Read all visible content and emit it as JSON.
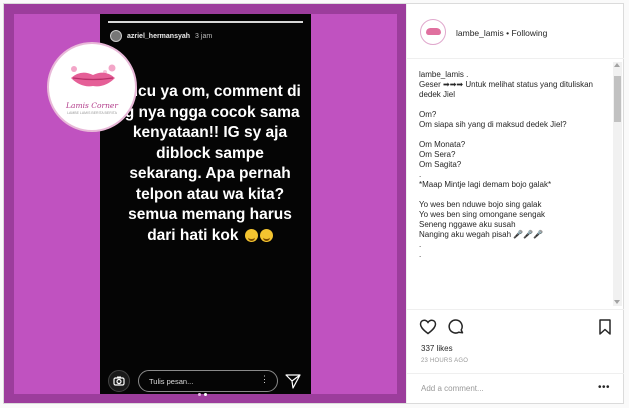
{
  "story": {
    "username": "azriel_hermansyah",
    "time": "3 jam",
    "text": "Lucu ya om, comment di ig nya ngga cocok sama kenyataan!! IG sy aja diblock sampe sekarang. Apa pernah telpon atau wa kita? semua memang harus dari hati kok",
    "reply_placeholder": "Tulis pesan...",
    "reply_more": "⋮"
  },
  "logo": {
    "name": "Lamis Corner",
    "tagline": "LAMBE LAMIS BERITA BERITA"
  },
  "post": {
    "username": "lambe_lamis",
    "separator": "•",
    "follow_status": "Following",
    "caption_user": "lambe_lamis",
    "caption_lines": [
      "lambe_lamis .",
      "Geser ➡➡➡ Untuk melihat status yang dituliskan dedek Jiel",
      "",
      "Om?",
      "Om siapa sih yang di maksud dedek Jiel?",
      "",
      "Om Monata?",
      "Om Sera?",
      "Om Sagita?",
      ".",
      "*Maap Mintje lagi demam bojo galak*",
      "",
      "Yo wes ben nduwe bojo sing galak",
      "Yo wes ben sing omongane sengak",
      "Seneng nggawe aku susah",
      "Nanging aku wegah pisah 🎤🎤🎤",
      ".",
      "."
    ],
    "likes": "337 likes",
    "timestamp": "23 HOURS AGO",
    "comment_placeholder": "Add a comment...",
    "comment_more": "•••"
  },
  "icons": {
    "like": "heart-icon",
    "comment": "comment-icon",
    "save": "bookmark-icon",
    "camera": "camera-icon",
    "send": "send-icon"
  },
  "colors": {
    "media_bg": "#c052c0",
    "media_border": "#9c3d9c",
    "story_bg": "#050505"
  }
}
